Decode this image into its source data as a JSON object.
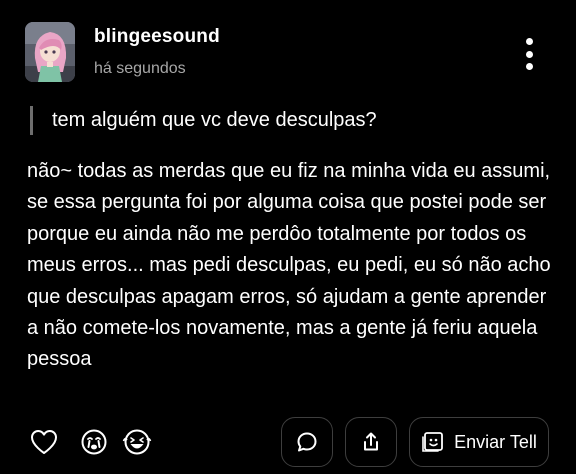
{
  "post": {
    "username": "blingeesound",
    "timestamp": "há segundos",
    "question": "tem alguém que vc deve desculpas?",
    "answer": "não~ todas as merdas que eu fiz na minha vida eu assumi, se essa pergunta foi por alguma coisa que postei pode ser porque eu ainda não me perdôo totalmente por todos os meus erros... mas pedi desculpas, eu pedi, eu só não acho que desculpas apagam erros, só ajudam a gente aprender a não comete-los novamente, mas a gente já feriu aquela pessoa"
  },
  "actions": {
    "send_label": "Enviar Tell",
    "icons": [
      "heart-icon",
      "crying-face-icon",
      "laughing-face-icon",
      "reply-bubble-icon",
      "share-icon",
      "tell-icon"
    ]
  },
  "colors": {
    "background": "#000000",
    "text": "#ffffff",
    "muted": "#a7a7a7",
    "quote_bar": "#6e6e6e",
    "pill_border": "#3e3e3e"
  }
}
